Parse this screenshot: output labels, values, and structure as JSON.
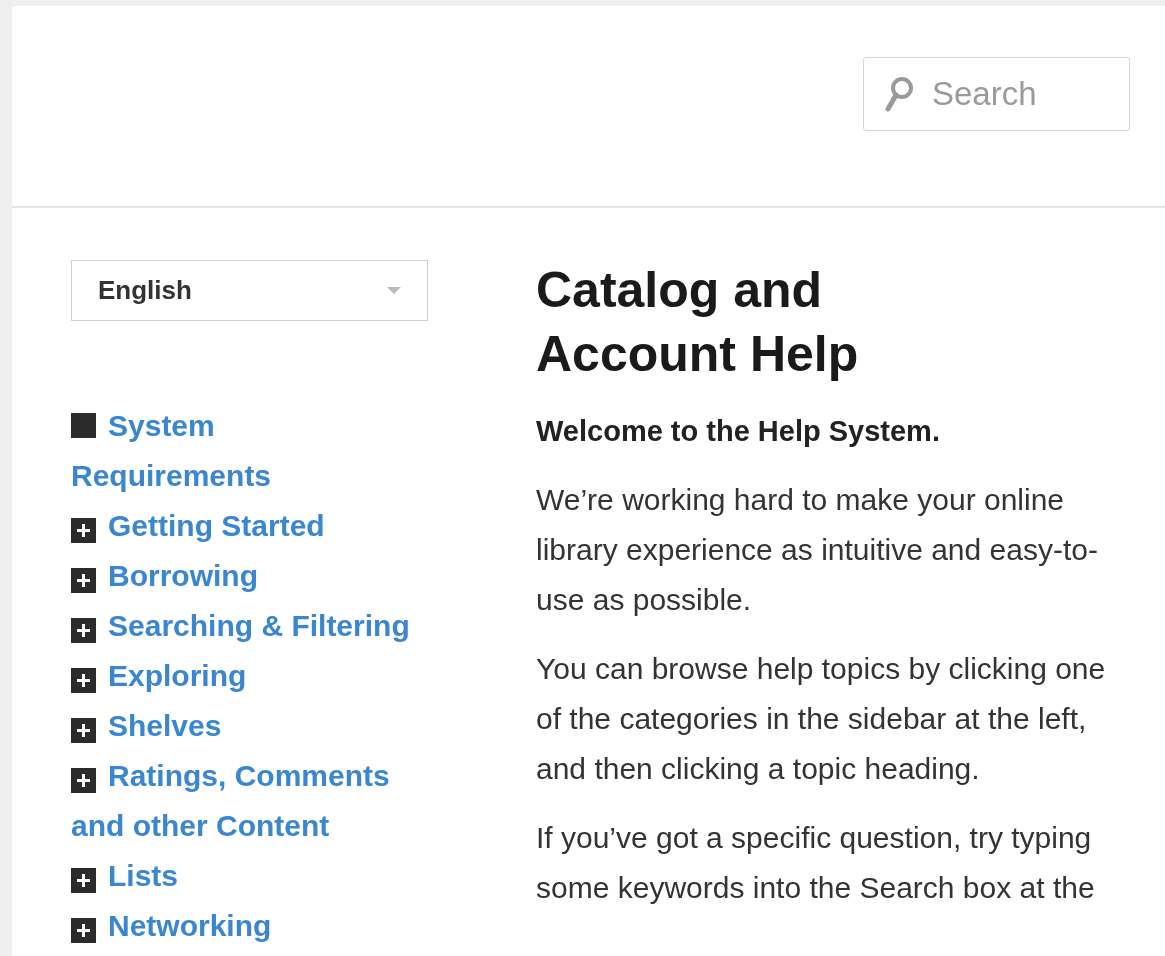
{
  "header": {
    "search": {
      "placeholder": "Search"
    }
  },
  "sidebar": {
    "language": "English",
    "items": [
      {
        "label": "System Requirements",
        "expanded": true
      },
      {
        "label": "Getting Started",
        "expanded": false
      },
      {
        "label": "Borrowing",
        "expanded": false
      },
      {
        "label": "Searching & Filtering",
        "expanded": false
      },
      {
        "label": "Exploring",
        "expanded": false
      },
      {
        "label": "Shelves",
        "expanded": false
      },
      {
        "label": "Ratings, Comments and other Content",
        "expanded": false
      },
      {
        "label": "Lists",
        "expanded": false
      },
      {
        "label": "Networking",
        "expanded": false
      }
    ]
  },
  "content": {
    "title": "Catalog and Account Help",
    "intro": "Welcome to the Help System.",
    "paragraphs": [
      "We’re working hard to make your online library experience as intuitive and easy-to-use as possible.",
      "You can browse help topics by clicking one of the categories in the sidebar at the left, and then clicking a topic heading.",
      "If you’ve got a specific question, try typing some keywords into the Search box at the"
    ]
  }
}
